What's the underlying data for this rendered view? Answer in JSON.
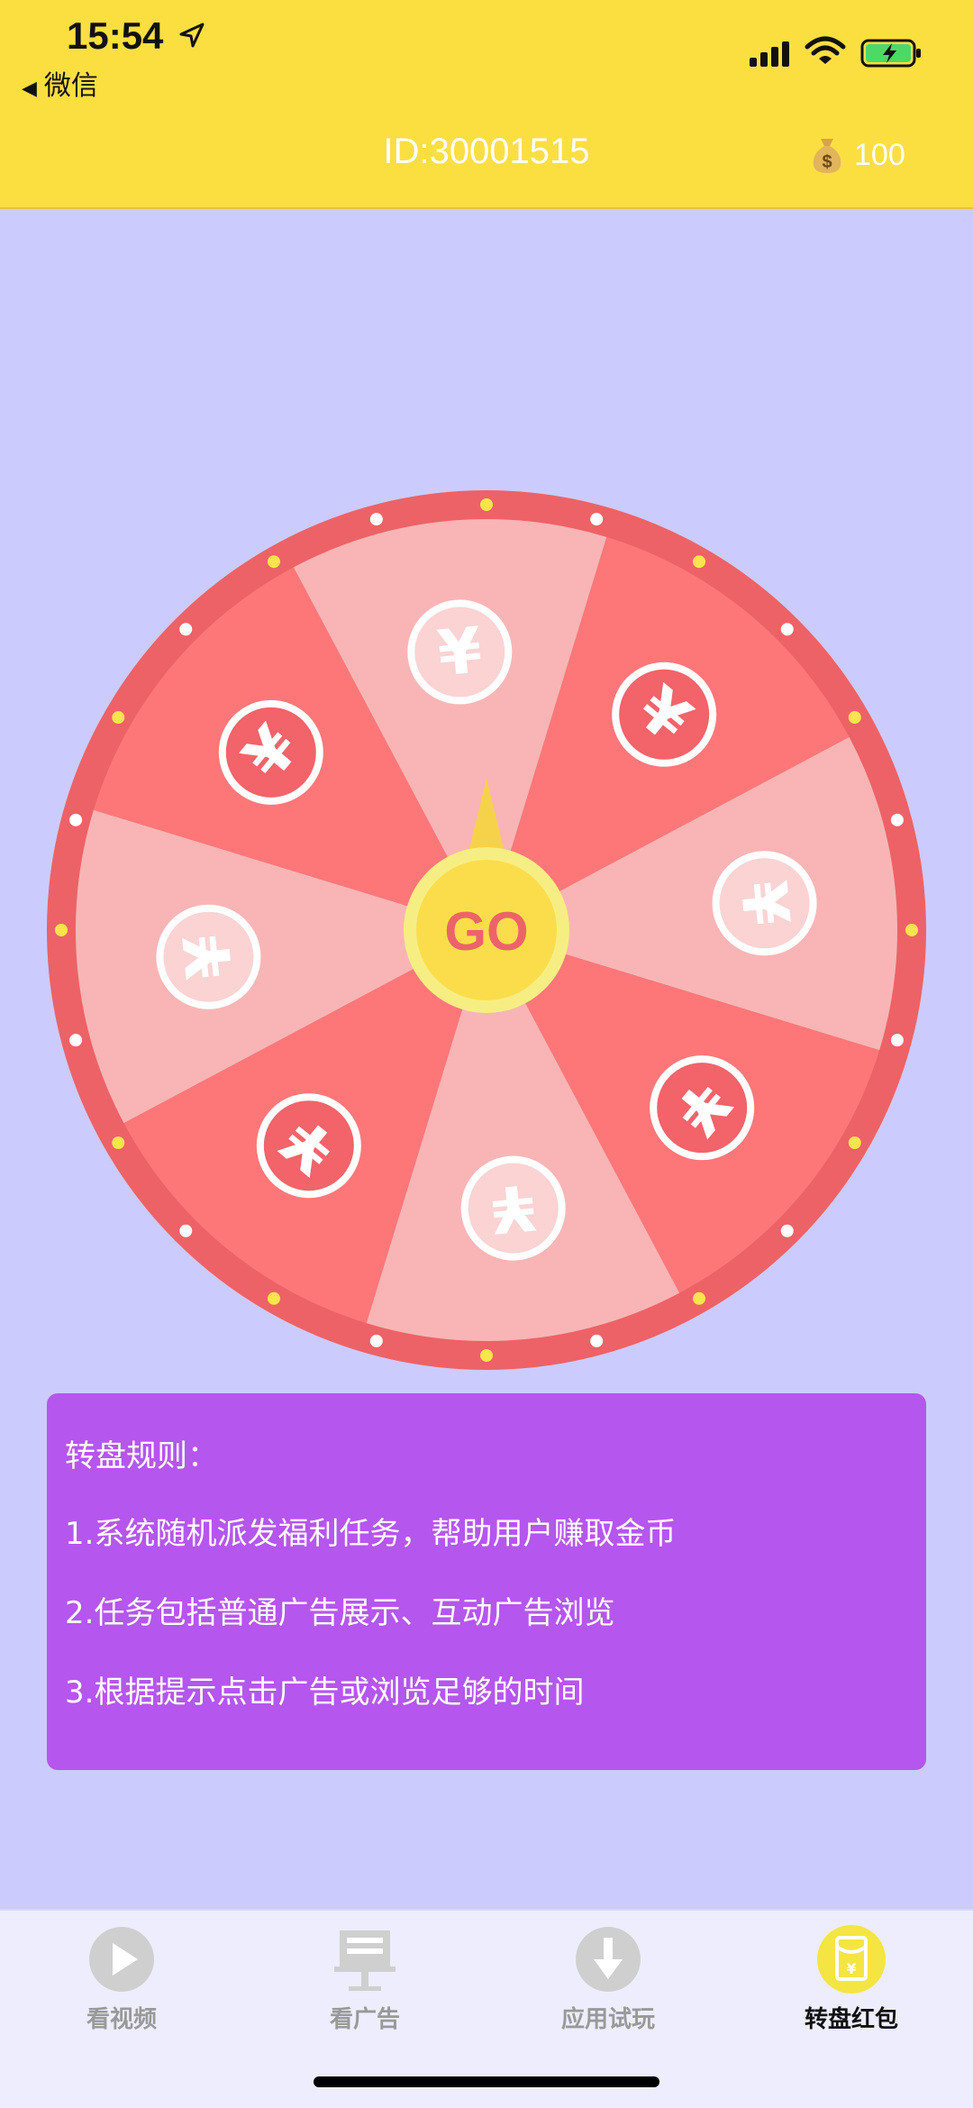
{
  "status_bar": {
    "time": "15:54",
    "back_label": "微信"
  },
  "header": {
    "user_id": "ID:30001515",
    "coins": "100"
  },
  "wheel": {
    "center_label": "GO",
    "segment_symbol": "¥",
    "colors": {
      "rim": "#ed6266",
      "dark": "#fd7779",
      "light": "#f9b5b5",
      "hub": "#fbdd4c",
      "dot_yellow": "#fbe54d",
      "dot_white": "#ffffff"
    }
  },
  "rules": {
    "title": "转盘规则：",
    "lines": [
      "1.系统随机派发福利任务，帮助用户赚取金币",
      "2.任务包括普通广告展示、互动广告浏览",
      "3.根据提示点击广告或浏览足够的时间"
    ]
  },
  "tabs": [
    {
      "label": "看视频",
      "icon": "play-icon"
    },
    {
      "label": "看广告",
      "icon": "billboard-icon"
    },
    {
      "label": "应用试玩",
      "icon": "download-icon"
    },
    {
      "label": "转盘红包",
      "icon": "red-envelope-icon"
    }
  ],
  "active_tab": 3
}
